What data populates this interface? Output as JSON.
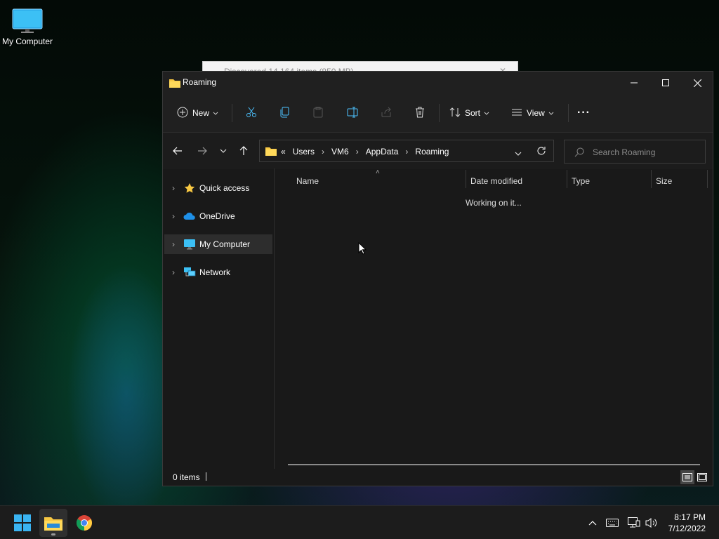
{
  "desktop": {
    "icon_label": "My Computer"
  },
  "background_window": {
    "title": "Discovered 14,164 items (850 MB)"
  },
  "window": {
    "title": "Roaming"
  },
  "toolbar": {
    "new_label": "New",
    "sort_label": "Sort",
    "view_label": "View",
    "more_label": "···"
  },
  "address": {
    "overflow": "«",
    "crumbs": [
      "Users",
      "VM6",
      "AppData",
      "Roaming"
    ]
  },
  "search": {
    "placeholder": "Search Roaming"
  },
  "nav_pane": {
    "items": [
      {
        "label": "Quick access",
        "icon": "star-icon"
      },
      {
        "label": "OneDrive",
        "icon": "cloud-icon"
      },
      {
        "label": "My Computer",
        "icon": "monitor-icon",
        "selected": true
      },
      {
        "label": "Network",
        "icon": "network-icon"
      }
    ]
  },
  "columns": [
    "Name",
    "Date modified",
    "Type",
    "Size"
  ],
  "status": {
    "working": "Working on it...",
    "item_count": "0 items"
  },
  "taskbar": {
    "time": "8:17 PM",
    "date": "7/12/2022"
  },
  "colors": {
    "accent": "#4cc2ff",
    "folder": "#f8c843",
    "background": "#191919"
  }
}
